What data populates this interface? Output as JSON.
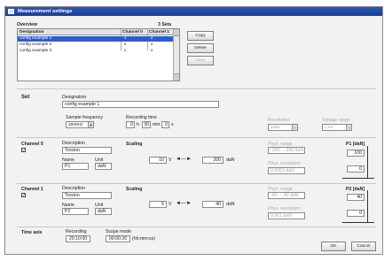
{
  "window": {
    "title": "Measurement settings"
  },
  "overview": {
    "label": "Overview",
    "sets_count": "3 Sets",
    "headers": [
      "Designation",
      "Channel 0",
      "Channel 1"
    ],
    "rows": [
      {
        "name": "config example 1",
        "c0": "x",
        "c1": "x"
      },
      {
        "name": "config example 2",
        "c0": "x",
        "c1": "x"
      },
      {
        "name": "config example 3",
        "c0": "x",
        "c1": "x"
      }
    ],
    "copy": "Copy",
    "delete": "Delete",
    "save": "Save"
  },
  "set": {
    "label": "Set",
    "designation_label": "Designation",
    "designation_value": "config example 1",
    "sample_freq_label": "Sample frequency",
    "sample_freq_value": "2000Hz",
    "rec_time_label": "Recording time",
    "rec_h": "0",
    "h_unit": "h",
    "rec_min": "30",
    "min_unit": "min",
    "rec_s": "0",
    "s_unit": "s",
    "resolution_label": "Resolution",
    "resolution_value": "16Bit",
    "voltage_label": "Voltage range",
    "voltage_value": "± 5V"
  },
  "ch0": {
    "label": "Channel 0",
    "desc_label": "Description",
    "desc_value": "Torsion",
    "name_label": "Name",
    "name_value": "P1",
    "unit_label": "Unit",
    "unit_value": "daN",
    "scaling_label": "Scaling",
    "v_value": "10",
    "v_unit": "V",
    "arrow": "◄—►",
    "phys_value": "200",
    "phys_unit": "daN",
    "phys_range_label": "Phys. range",
    "phys_range_value": "-200 ... 200 daN",
    "phys_res_label": "Phys. resolution",
    "phys_res_value": "0,0061 daN",
    "axis_label": "P1 [daN]",
    "y_top": "100",
    "y_bottom": "0"
  },
  "ch1": {
    "label": "Channel 1",
    "desc_label": "Description",
    "desc_value": "Torsion",
    "name_label": "Name",
    "name_value": "P2",
    "unit_label": "Unit",
    "unit_value": "daN",
    "scaling_label": "Scaling",
    "v_value": "5",
    "v_unit": "V",
    "arrow": "◄—►",
    "phys_value": "40",
    "phys_unit": "daN",
    "phys_range_label": "Phys. range",
    "phys_range_value": "-40 ... 40 daN",
    "phys_res_label": "Phys. resolution",
    "phys_res_value": "0,001 daN",
    "axis_label": "P2 [daN]",
    "y_top": "40",
    "y_bottom": "0"
  },
  "time": {
    "label": "Time axis",
    "recording_label": "Recording",
    "recording_value": "20:10:00",
    "scope_label": "Scope mode",
    "scope_value": "00:00:20",
    "scope_unit": "(hh:mm:ss)"
  },
  "footer": {
    "ok": "OK",
    "cancel": "Cancel"
  },
  "check_mark": "✓"
}
